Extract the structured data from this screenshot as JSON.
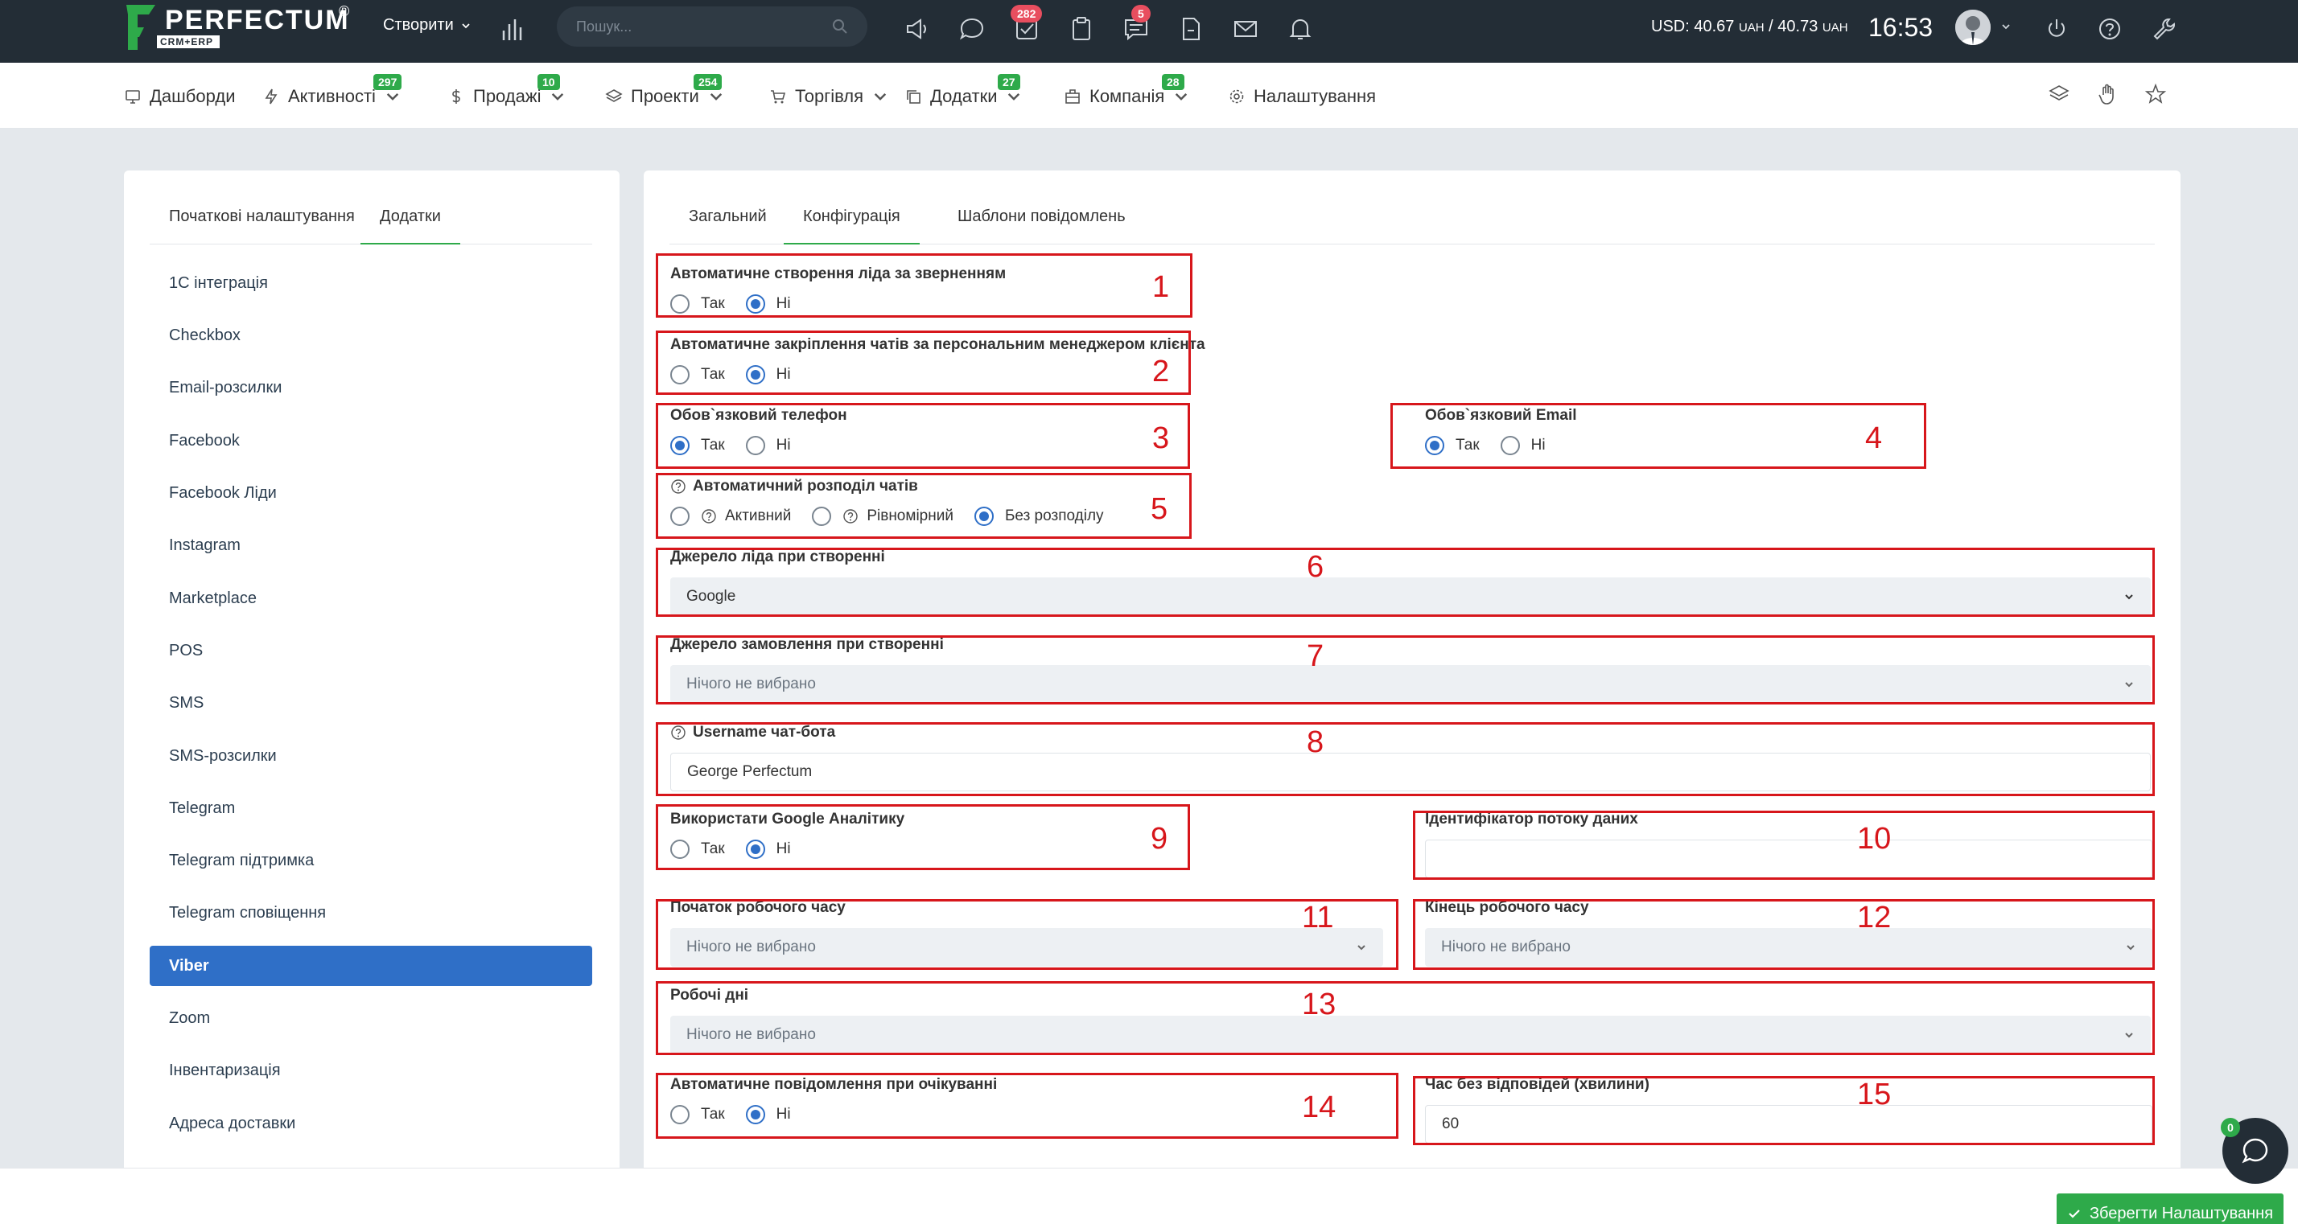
{
  "header": {
    "logo_text": "PERFECTUM",
    "logo_sub": "CRM+ERP",
    "logo_reg": "®",
    "create_label": "Створити",
    "search_placeholder": "Пошук...",
    "badges": {
      "tasks": "282",
      "messages": "5"
    },
    "currency_usd": "USD: 40.67",
    "currency_uah1": "UAH",
    "currency_sep": " / 40.73",
    "currency_uah2": "UAH",
    "time": "16:53"
  },
  "menu": {
    "items": [
      {
        "label": "Дашборди",
        "icon": "monitor-icon"
      },
      {
        "label": "Активності",
        "badge": "297",
        "icon": "bolt-icon"
      },
      {
        "label": "Продажі",
        "badge": "10",
        "icon": "dollar-icon"
      },
      {
        "label": "Проекти",
        "badge": "254",
        "icon": "layers-icon"
      },
      {
        "label": "Торгівля",
        "icon": "cart-icon"
      },
      {
        "label": "Додатки",
        "badge": "27",
        "icon": "copy-icon"
      },
      {
        "label": "Компанія",
        "badge": "28",
        "icon": "building-icon"
      },
      {
        "label": "Налаштування",
        "icon": "gear-icon"
      }
    ]
  },
  "left": {
    "tabs": [
      "Початкові налаштування",
      "Додатки"
    ],
    "items": [
      "1С інтеграція",
      "Checkbox",
      "Email-розсилки",
      "Facebook",
      "Facebook Ліди",
      "Instagram",
      "Marketplace",
      "POS",
      "SMS",
      "SMS-розсилки",
      "Telegram",
      "Telegram підтримка",
      "Telegram сповіщення",
      "Viber",
      "Zoom",
      "Інвентаризація",
      "Адреса доставки"
    ],
    "active": "Viber"
  },
  "right": {
    "tabs": [
      "Загальний",
      "Конфігурація",
      "Шаблони повідомлень"
    ]
  },
  "form": {
    "yes": "Так",
    "no": "Ні",
    "f1": "Автоматичне створення ліда за зверненням",
    "f2": "Автоматичне закріплення чатів за персональним менеджером клієнта",
    "f3": "Обов`язковий телефон",
    "f4": "Обов`язковий Email",
    "f5": "Автоматичний розподіл чатів",
    "f5_opts": [
      "Активний",
      "Рівномірний",
      "Без розподілу"
    ],
    "f6": "Джерело ліда при створенні",
    "f6_value": "Google",
    "f7": "Джерело замовлення при створенні",
    "nothing": "Нічого не вибрано",
    "f8": "Username чат-бота",
    "f8_value": "George Perfectum",
    "f9": "Використати Google Аналітику",
    "f10": "Ідентифікатор потоку даних",
    "f10_value": "",
    "f11": "Початок робочого часу",
    "f12": "Кінець робочого часу",
    "f13": "Робочі дні",
    "f14": "Автоматичне повідомлення при очікуванні",
    "f15": "Час без відповідей (хвилини)",
    "f15_value": "60"
  },
  "annotations": [
    "1",
    "2",
    "3",
    "4",
    "5",
    "6",
    "7",
    "8",
    "9",
    "10",
    "11",
    "12",
    "13",
    "14",
    "15"
  ],
  "footer": {
    "save_label": "Зберегти Налаштування",
    "chat_badge": "0"
  },
  "colors": {
    "accent_green": "#2eaa4a",
    "accent_blue": "#2f6fc7",
    "annotation_red": "#d7161b",
    "topbar": "#232d36"
  }
}
